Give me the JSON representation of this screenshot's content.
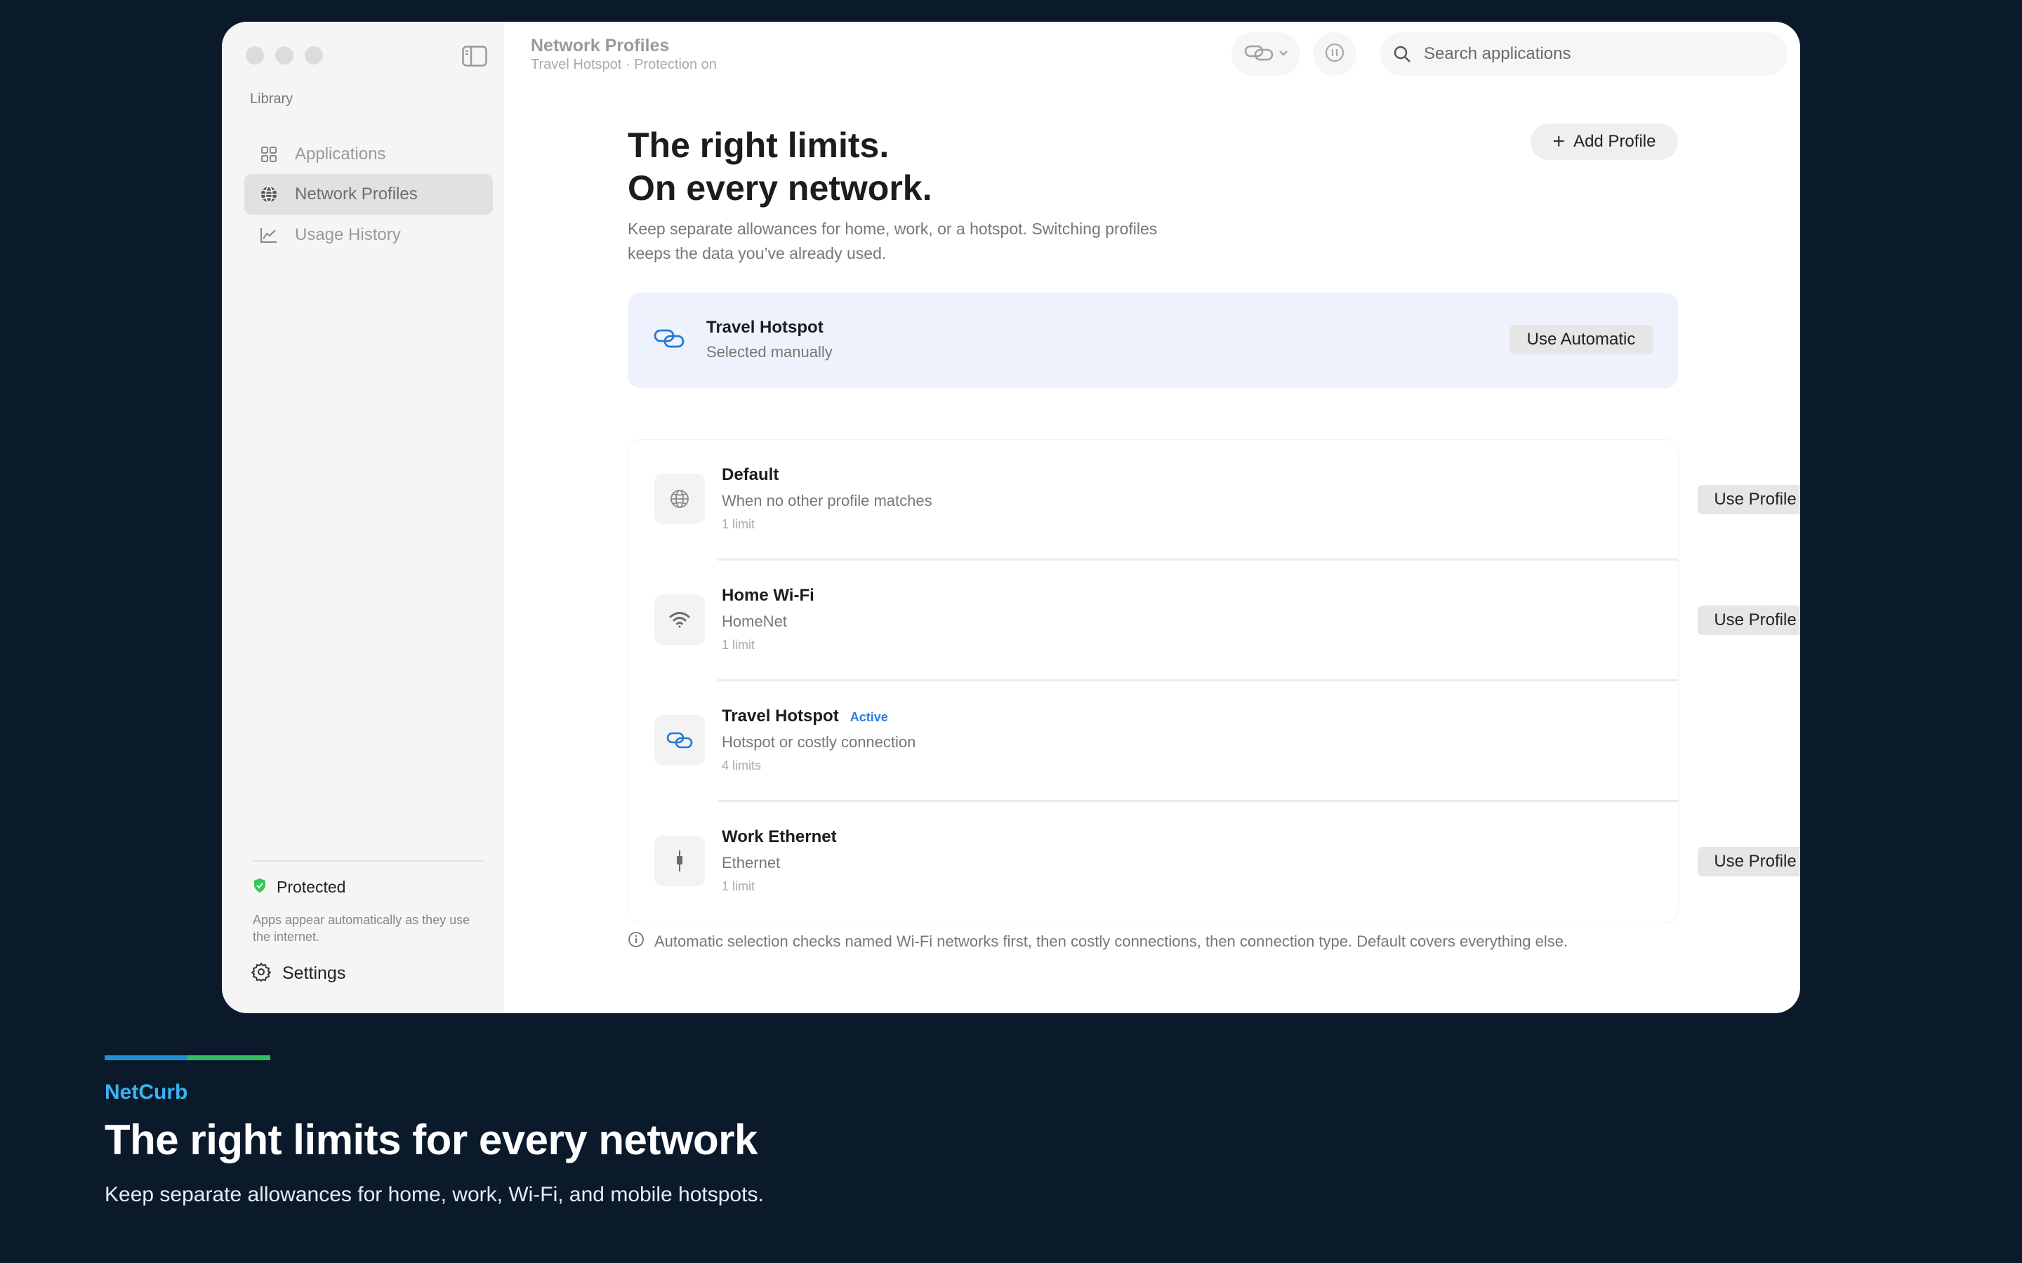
{
  "window": {
    "title": "Network Profiles",
    "subtitle": "Travel Hotspot · Protection on"
  },
  "search": {
    "placeholder": "Search applications"
  },
  "sidebar": {
    "section_label": "Library",
    "items": [
      {
        "label": "Applications",
        "icon": "grid-icon"
      },
      {
        "label": "Network Profiles",
        "icon": "globe-icon",
        "selected": true
      },
      {
        "label": "Usage History",
        "icon": "chart-icon"
      }
    ],
    "status": {
      "label": "Protected",
      "note": "Apps appear automatically as they use the internet."
    },
    "settings_label": "Settings"
  },
  "main": {
    "title_line1": "The right limits.",
    "title_line2": "On every network.",
    "description": "Keep separate allowances for home, work, or a hotspot. Switching profiles keeps the data you’ve already used.",
    "add_button": "Add Profile",
    "current": {
      "name": "Travel Hotspot",
      "status": "Selected manually",
      "button": "Use Automatic"
    },
    "profiles": [
      {
        "name": "Default",
        "subtitle": "When no other profile matches",
        "limits": "1 limit",
        "action": "Use Profile",
        "icon": "globe-icon",
        "active": false
      },
      {
        "name": "Home Wi-Fi",
        "subtitle": "HomeNet",
        "limits": "1 limit",
        "action": "Use Profile",
        "icon": "wifi-icon",
        "active": false
      },
      {
        "name": "Travel Hotspot",
        "badge": "Active",
        "subtitle": "Hotspot or costly connection",
        "limits": "4 limits",
        "icon": "link-icon",
        "active": true
      },
      {
        "name": "Work Ethernet",
        "subtitle": "Ethernet",
        "limits": "1 limit",
        "action": "Use Profile",
        "icon": "ethernet-icon",
        "active": false
      }
    ],
    "footnote": "Automatic selection checks named Wi-Fi networks first, then costly connections, then connection type. Default covers everything else."
  },
  "marketing": {
    "brand": "NetCurb",
    "headline": "The right limits for every network",
    "subheadline": "Keep separate allowances for home, work, Wi-Fi, and mobile hotspots."
  },
  "colors": {
    "background": "#0b1a2b",
    "brand": "#3ab4f2",
    "accent_blue": "#1f8fd6",
    "accent_green": "#2fbf5c",
    "active_badge": "#2d7ee0",
    "protected_green": "#34c759"
  }
}
